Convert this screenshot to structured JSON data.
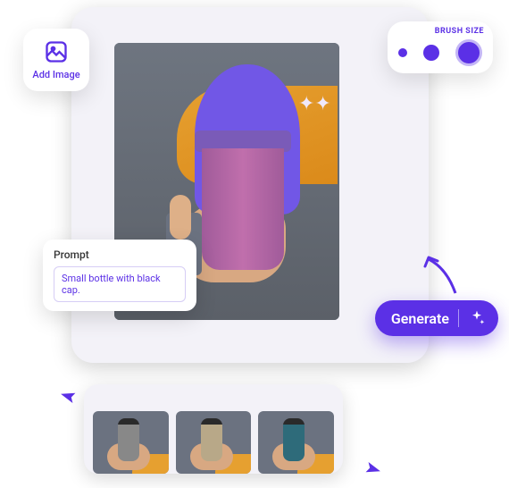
{
  "addImage": {
    "label": "Add Image"
  },
  "brush": {
    "label": "BRUSH SIZE",
    "sizes": [
      {
        "name": "small"
      },
      {
        "name": "medium"
      },
      {
        "name": "large",
        "selected": true
      }
    ]
  },
  "prompt": {
    "title": "Prompt",
    "value": "Small bottle with black cap."
  },
  "generate": {
    "label": "Generate"
  },
  "canvas": {
    "description": "Hand holding a cup with purple brush mask applied"
  },
  "results": [
    {
      "description": "Hand holding grey bottle with black cap"
    },
    {
      "description": "Hand holding tan bottle with black cap"
    },
    {
      "description": "Hand holding teal bottle with black cap"
    }
  ],
  "colors": {
    "accent": "#5b30e6"
  }
}
